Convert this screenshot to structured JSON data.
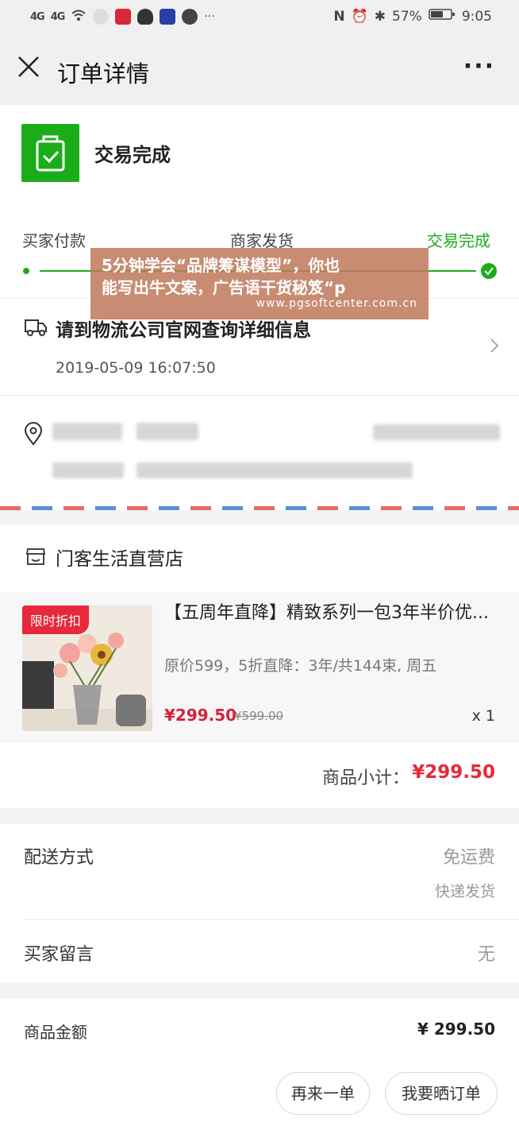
{
  "status_bar": {
    "signal1": "4G",
    "signal2": "4G",
    "battery": "57%",
    "time": "9:05",
    "more": "···"
  },
  "nav": {
    "title": "订单详情",
    "more": "···"
  },
  "order_status": {
    "title": "交易完成",
    "steps": [
      "买家付款",
      "商家发货",
      "交易完成"
    ]
  },
  "logistics": {
    "title": "请到物流公司官网查询详细信息",
    "time": "2019-05-09 16:07:50"
  },
  "store": {
    "name": "门客生活直营店"
  },
  "product": {
    "badge": "限时折扣",
    "title": "【五周年直降】精致系列一包3年半价优...",
    "subtitle": "原价599，5折直降：3年/共144束, 周五",
    "price": "¥299.50",
    "original_price": "¥599.00",
    "quantity": "x 1"
  },
  "subtotal": {
    "label": "商品小计：",
    "value": "¥299.50"
  },
  "shipping": {
    "label": "配送方式",
    "value": "免运费",
    "method": "快递发货"
  },
  "message": {
    "label": "买家留言",
    "value": "无"
  },
  "amount": {
    "label": "商品金额",
    "value": "¥ 299.50"
  },
  "actions": {
    "reorder": "再来一单",
    "share": "我要晒订单"
  },
  "overlay": {
    "line1": "5分钟学会“品牌筹谋模型”，你也",
    "line2": "能写出牛文案，广告语干货秘笈“p",
    "url": "www.pgsoftcenter.com.cn"
  },
  "colors": {
    "accent_green": "#1aad19",
    "price_red": "#e8283b"
  }
}
